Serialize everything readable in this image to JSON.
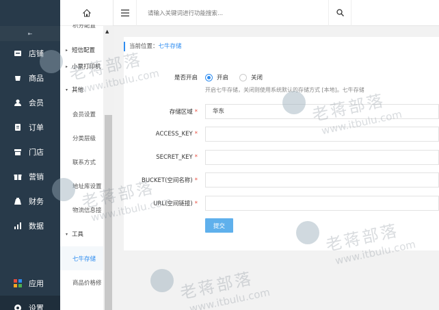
{
  "sidebar": {
    "collapse_icon": "⇤",
    "items": [
      {
        "label": "店铺",
        "icon": "store-icon"
      },
      {
        "label": "商品",
        "icon": "goods-icon"
      },
      {
        "label": "会员",
        "icon": "member-icon"
      },
      {
        "label": "订单",
        "icon": "order-icon"
      },
      {
        "label": "门店",
        "icon": "shop-icon"
      },
      {
        "label": "营销",
        "icon": "marketing-icon"
      },
      {
        "label": "财务",
        "icon": "finance-icon"
      },
      {
        "label": "数据",
        "icon": "data-icon"
      },
      {
        "label": "应用",
        "icon": "apps-icon"
      },
      {
        "label": "设置",
        "icon": "settings-icon"
      }
    ]
  },
  "subnav": {
    "top_partial": "积分配置",
    "groups": [
      {
        "label": "短信配置"
      },
      {
        "label": "小票打印机"
      },
      {
        "label": "其他"
      }
    ],
    "other_items": [
      "会员设置",
      "分类层级",
      "联系方式",
      "地址库设置",
      "物流信息接"
    ],
    "tools_group": "工具",
    "tools_items": [
      "七牛存储",
      "商品价格修"
    ]
  },
  "topbar": {
    "search_placeholder": "请输入关键词进行功能搜索..."
  },
  "breadcrumb": {
    "prefix": "当前位置：",
    "current": "七牛存储"
  },
  "form": {
    "enable_label": "是否开启",
    "option_on": "开启",
    "option_off": "关闭",
    "hint": "开启七牛存储，关闭则使用系统默认的存储方式 [本地]。七牛存储",
    "region_label": "存储区域",
    "region_value": "华东",
    "access_key_label": "ACCESS_KEY",
    "secret_key_label": "SECRET_KEY",
    "bucket_label": "BUCKET(空间名称)",
    "url_label": "URL(空间链接)",
    "submit_label": "提交"
  },
  "watermark": {
    "text": "老蒋部落",
    "url": "www.itbulu.com"
  },
  "colors": {
    "sidebar_bg": "#283a4a",
    "accent": "#2d8cf0",
    "submit_bg": "#5fb0ec",
    "required": "#e84c3d"
  }
}
